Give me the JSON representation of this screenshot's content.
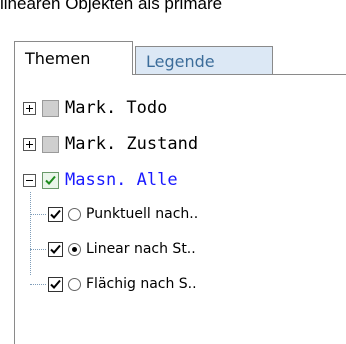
{
  "header_text": "linearen Objekten als primäre",
  "tabs": [
    {
      "label": "Themen",
      "active": true
    },
    {
      "label": "Legende",
      "active": false
    }
  ],
  "tree": {
    "items": [
      {
        "label": "Mark. Todo",
        "expanded": false,
        "checked": false
      },
      {
        "label": "Mark. Zustand",
        "expanded": false,
        "checked": false
      },
      {
        "label": "Massn. Alle",
        "expanded": true,
        "checked": true,
        "children": [
          {
            "label": "Punktuell nach..",
            "checked": true,
            "radio_selected": false
          },
          {
            "label": "Linear nach St..",
            "checked": true,
            "radio_selected": true
          },
          {
            "label": "Flächig nach S..",
            "checked": true,
            "radio_selected": false
          }
        ]
      }
    ]
  },
  "colors": {
    "accent_label": "#1a1aff",
    "inactive_tab_bg": "#dce8f5",
    "inactive_tab_text": "#3c6d9a"
  }
}
